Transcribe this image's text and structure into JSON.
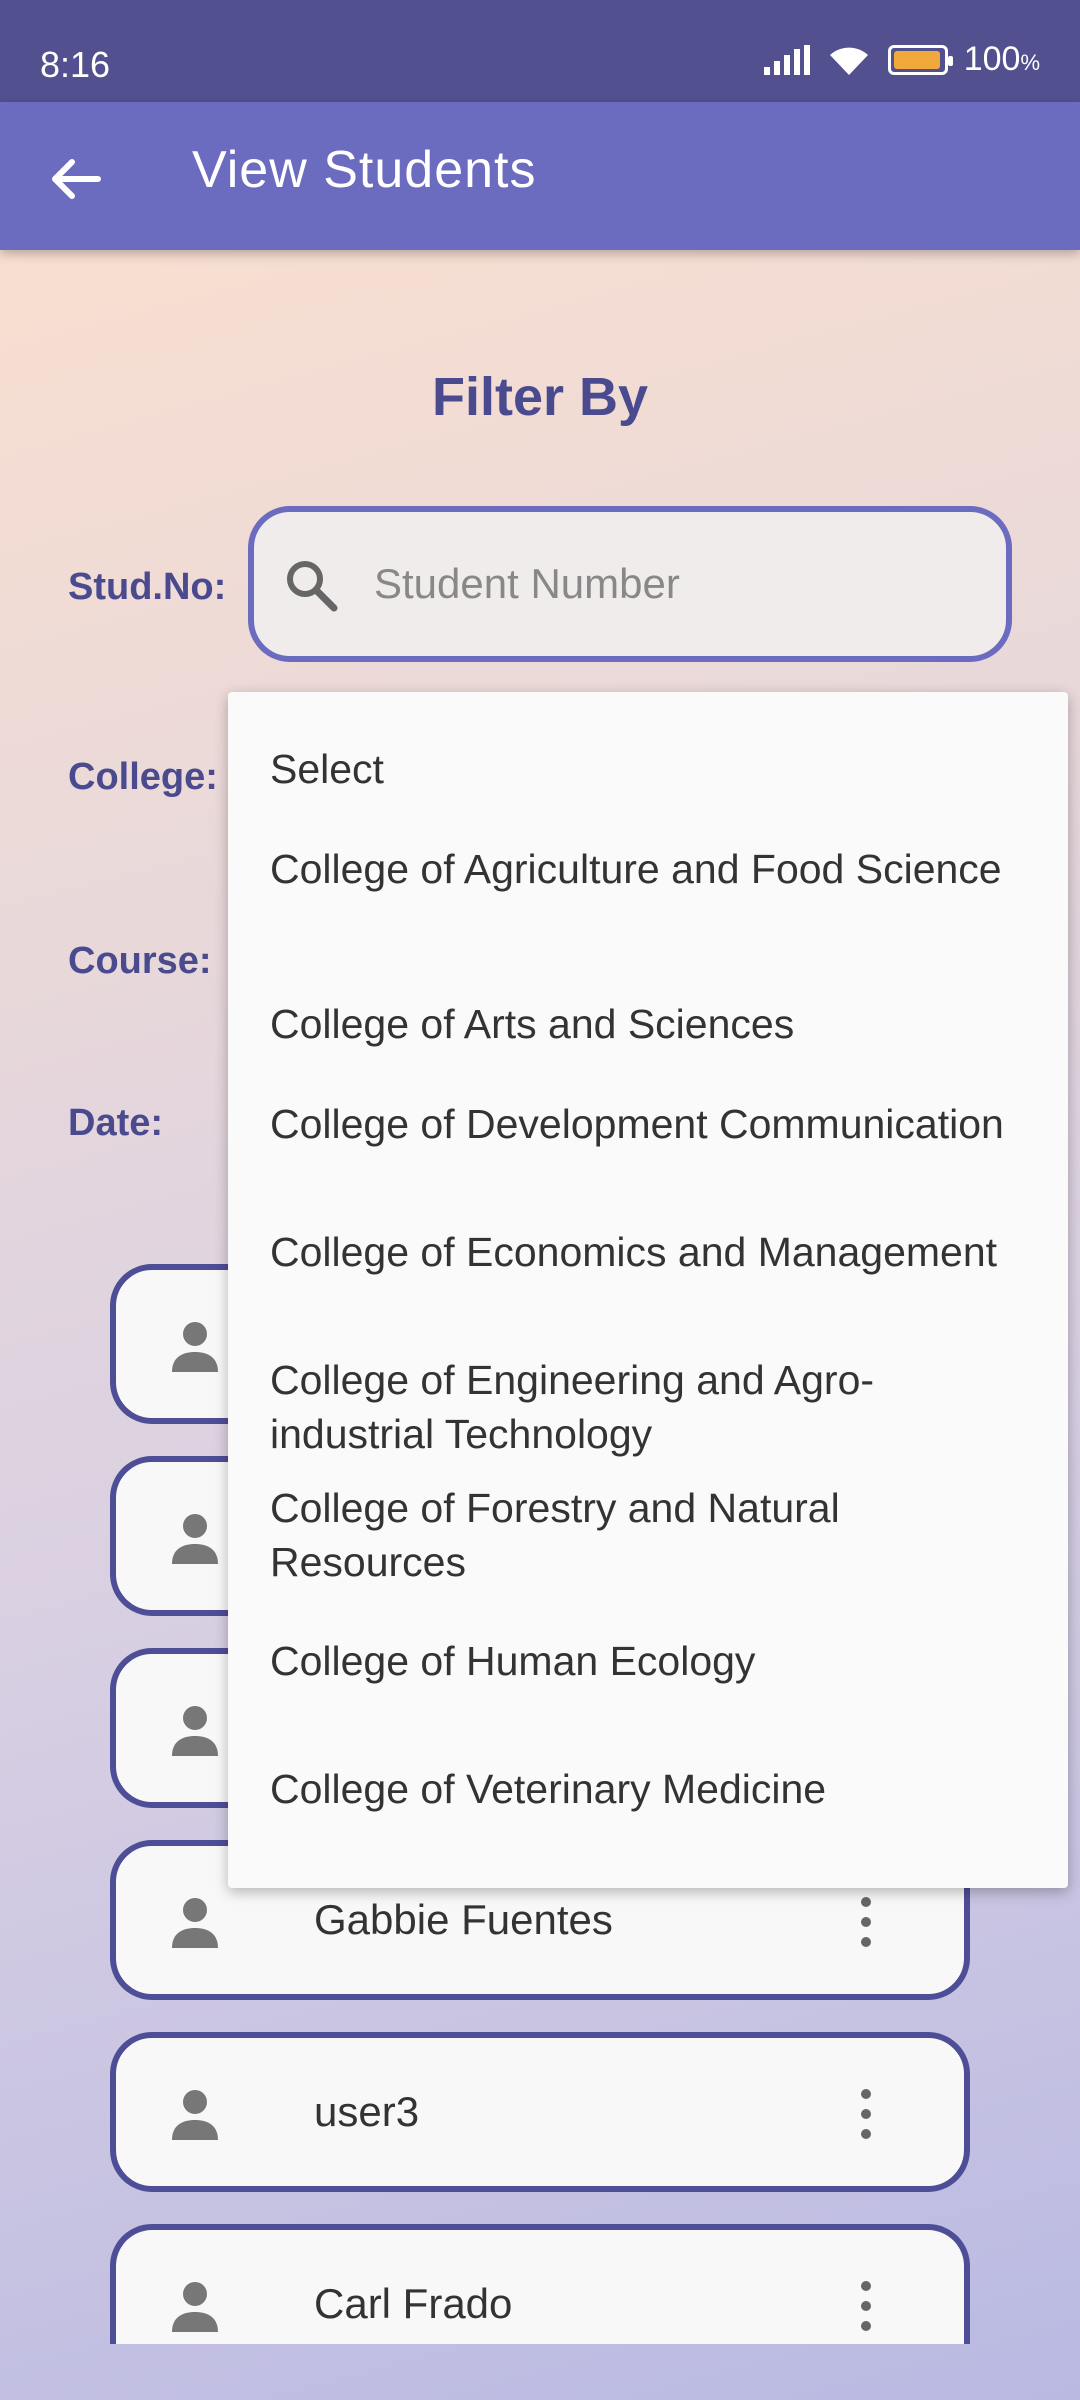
{
  "status_bar": {
    "time": "8:16",
    "battery_text": "100"
  },
  "app_bar": {
    "title": "View Students"
  },
  "filter": {
    "title": "Filter By",
    "stud_no_label": "Stud.No:",
    "college_label": "College:",
    "course_label": "Course:",
    "date_label": "Date:",
    "search_placeholder": "Student Number",
    "search_value": ""
  },
  "dropdown": {
    "items": [
      "Select",
      "College of Agriculture and Food Science",
      "College of Arts and Sciences",
      "College of Development Communication",
      "College of Economics and Management",
      "College of Engineering and Agro-industrial Technology",
      "College of Forestry and Natural Resources",
      "College of Human Ecology",
      "College of Veterinary Medicine"
    ]
  },
  "students": [
    {
      "name": ""
    },
    {
      "name": ""
    },
    {
      "name": ""
    },
    {
      "name": "Gabbie Fuentes"
    },
    {
      "name": "user3"
    },
    {
      "name": "Carl Frado"
    }
  ],
  "colors": {
    "status_bar": "#52508f",
    "app_bar": "#6b6bc0",
    "accent_text": "#4a4a8e",
    "card_border": "#4e4e96",
    "battery": "#f2a93b"
  },
  "icons": [
    "back-arrow-icon",
    "search-icon",
    "person-icon",
    "more-vert-icon",
    "signal-icon",
    "wifi-icon",
    "battery-icon"
  ]
}
